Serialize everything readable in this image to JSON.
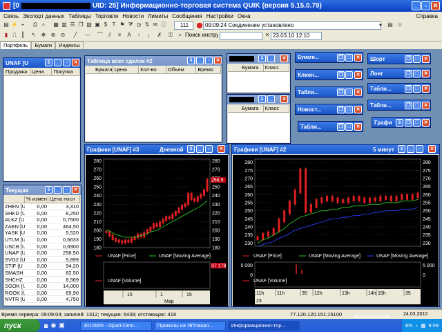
{
  "app": {
    "title": "UID: 25] Информационно-торговая система QUIK (версия 5.15.0.79)",
    "title_prefix": "[0"
  },
  "menu": {
    "items": [
      "Связь",
      "Экспорт данных",
      "Таблицы",
      "Торговля",
      "Новости",
      "Лимиты",
      "Сообщения",
      "Настройки",
      "Окна"
    ],
    "help": "Справка"
  },
  "toolbar": {
    "counter": "111",
    "connection_time": "09:09:24",
    "connection_status": "Соединение установлено",
    "search_label": "Поиск инструмента",
    "datetime": "23.03.10 12:10"
  },
  "tabs": [
    "Портфель",
    "Бумаги",
    "Индексы"
  ],
  "quote_window": {
    "title": "UNAF [U",
    "cols": [
      "Продажа",
      "Цена",
      "Покупка"
    ]
  },
  "trades_window": {
    "title": "Таблица всех сделок #2",
    "cols": [
      "Бумага",
      "Цена",
      "Кол-во",
      "Объем",
      "Время"
    ]
  },
  "small_win1": {
    "cols": [
      "Бумага",
      "Класс"
    ]
  },
  "small_win2": {
    "cols": [
      "Бумага",
      "Класс"
    ]
  },
  "minis": {
    "m1": "Бумаги...",
    "m2": "Клиен...",
    "m3": "Табли...",
    "m4": "Новост...",
    "m5": "Табли...",
    "m6": "Шорт",
    "m7": "Лонг",
    "m8": "Табли...",
    "m9": "Табли...",
    "m10": "Графи"
  },
  "current_window": {
    "title": "Текущая",
    "cols": [
      "",
      "% измен",
      "Цена посл"
    ],
    "rows": [
      [
        "ZHEN [U",
        "0,00",
        "3,310"
      ],
      [
        "SHKD [U",
        "0,00",
        "8,250"
      ],
      [
        "ALKZ [U",
        "0,00",
        "0,7500"
      ],
      [
        "ZAEN [U",
        "0,00",
        "464,50"
      ],
      [
        "YASK [U",
        "0,00",
        "5,520"
      ],
      [
        "UTLM [U",
        "0,00",
        "0,6633"
      ],
      [
        "USCB [U",
        "0,00",
        "0,6900"
      ],
      [
        "UNAF [U",
        "0,00",
        "258,50"
      ],
      [
        "SVG2 [U",
        "0,00",
        "5,899"
      ],
      [
        "STIF [U",
        "0,00",
        "94,20"
      ],
      [
        "SMASH",
        "0,00",
        "82,50"
      ],
      [
        "SHCHZ",
        "0,00",
        "8,569"
      ],
      [
        "SGOK [U",
        "0,00",
        "14,000"
      ],
      [
        "RGOK [U",
        "0,00",
        "69,90"
      ],
      [
        "NVTR [U",
        "0,00",
        "4,750"
      ]
    ]
  },
  "chart1": {
    "title": "Графики [UNAF] #3",
    "period": "Дневной",
    "ticks": [
      "280",
      "270",
      "260",
      "250",
      "240",
      "230",
      "220",
      "210",
      "200",
      "190",
      "180"
    ],
    "last_label": "258,5",
    "legend": [
      "UNAF [Price]",
      "UNAF [Moving Average]"
    ],
    "vol_legend": "UNAF [Volume]",
    "vol_label": "37 178",
    "dates": [
      "15",
      "1",
      "15"
    ],
    "month": "Мар"
  },
  "chart2": {
    "title": "Графики [UNAF] #2",
    "period": "5 минут",
    "ticks": [
      "280",
      "275",
      "270",
      "265",
      "260",
      "255",
      "250",
      "245",
      "240",
      "235",
      "230"
    ],
    "legend": [
      "UNAF [Price]",
      "UNAF [Moving Average]",
      "UNAF [Moving Average]"
    ],
    "vol_tick": "5 000",
    "vol_zero": "0",
    "vol_legend": "UNAF [Volume]",
    "times": [
      "11h",
      "11h",
      "35",
      "12h",
      "13h",
      "14h",
      "15h",
      "35"
    ],
    "day": "23"
  },
  "status": {
    "text": "Время сервера: 09:09:04; записей: 1312; текущая: 6439; отстающая: 418",
    "ip": "77.120.120.151:15100"
  },
  "taskbar": {
    "start": "пуск",
    "tasks": [
      "3015505 - Alpari-Dem...",
      "Приколы на ЯПлакал...",
      "Информационно-тор..."
    ],
    "lang": "EN",
    "clock": "9:09",
    "date": "24.03.2010",
    "watermark": "ЯПЛАКАЛ.COM"
  },
  "colors": {
    "price": "#e02020",
    "ma1": "#28c828",
    "ma2": "#2a40ff",
    "volume": "#e02020"
  },
  "chart_data": [
    {
      "type": "line",
      "title": "Графики [UNAF] #3",
      "ylim": [
        180,
        282
      ],
      "series": [
        {
          "name": "UNAF [Price]",
          "values": [
            198,
            194,
            190,
            188,
            187,
            186,
            188,
            187,
            190,
            192,
            195,
            193,
            197,
            200,
            203,
            207,
            205,
            209,
            212,
            215,
            214,
            218,
            221,
            225,
            228,
            230,
            242,
            236,
            234,
            238,
            241,
            246,
            258
          ]
        },
        {
          "name": "UNAF [Moving Average]",
          "values": [
            200,
            199,
            197,
            195,
            194,
            193,
            192,
            192,
            192,
            192,
            193,
            194,
            195,
            196,
            198,
            199,
            200,
            202,
            204,
            206,
            208,
            210,
            212,
            214,
            216,
            218,
            220,
            222,
            224,
            226,
            228,
            231,
            234
          ]
        }
      ]
    },
    {
      "type": "line",
      "title": "Графики [UNAF] #2",
      "ylim": [
        228,
        282
      ],
      "series": [
        {
          "name": "UNAF [Price]",
          "values": [
            233,
            235,
            236,
            238,
            244,
            249,
            255,
            262,
            275,
            250,
            253,
            256,
            257,
            258,
            257,
            256,
            256,
            257,
            258,
            257,
            256,
            257,
            257,
            258,
            258,
            257,
            258,
            259,
            258,
            259,
            260
          ]
        },
        {
          "name": "UNAF [Moving Average]",
          "values": [
            230,
            232,
            233,
            235,
            237,
            239,
            242,
            244,
            246,
            247,
            248,
            249,
            250,
            250,
            251,
            251,
            252,
            252,
            253,
            253,
            253,
            254,
            254,
            254,
            255,
            255,
            255,
            256,
            256,
            256,
            257
          ]
        },
        {
          "name": "UNAF [Moving Average]",
          "values": [
            228,
            229,
            230,
            231,
            233,
            234,
            236,
            238,
            239,
            240,
            241,
            242,
            243,
            244,
            245,
            245,
            246,
            246,
            247,
            247,
            248,
            248,
            249,
            249,
            250,
            250,
            250,
            251,
            251,
            251,
            252
          ]
        }
      ]
    }
  ]
}
